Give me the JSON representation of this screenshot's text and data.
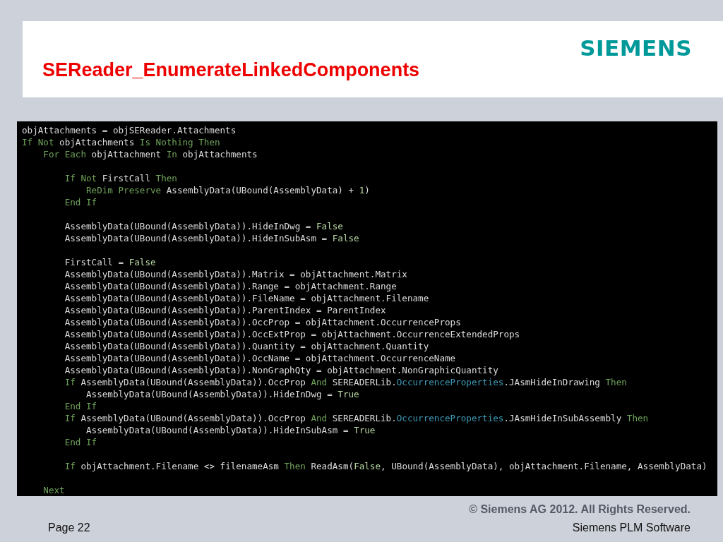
{
  "header": {
    "title": "SEReader_EnumerateLinkedComponents",
    "logo": "SIEMENS"
  },
  "code": [
    {
      "kind": "code",
      "tokens": [
        {
          "t": "objAttachments = objSEReader.Attachments",
          "kind": "plain"
        }
      ]
    },
    {
      "kind": "code",
      "tokens": [
        {
          "t": "If Not",
          "kind": "keyword"
        },
        {
          "t": " objAttachments ",
          "kind": "plain"
        },
        {
          "t": "Is Nothing Then",
          "kind": "keyword"
        }
      ]
    },
    {
      "kind": "code",
      "tokens": [
        {
          "t": "    For Each",
          "kind": "keyword"
        },
        {
          "t": " objAttachment ",
          "kind": "plain"
        },
        {
          "t": "In",
          "kind": "keyword"
        },
        {
          "t": " objAttachments",
          "kind": "plain"
        }
      ]
    },
    {
      "kind": "blank"
    },
    {
      "kind": "code",
      "tokens": [
        {
          "t": "        If Not",
          "kind": "keyword"
        },
        {
          "t": " FirstCall ",
          "kind": "plain"
        },
        {
          "t": "Then",
          "kind": "keyword"
        }
      ]
    },
    {
      "kind": "code",
      "tokens": [
        {
          "t": "            ReDim Preserve",
          "kind": "keyword"
        },
        {
          "t": " AssemblyData(UBound(AssemblyData) + ",
          "kind": "plain"
        },
        {
          "t": "1",
          "kind": "literal"
        },
        {
          "t": ")",
          "kind": "plain"
        }
      ]
    },
    {
      "kind": "code",
      "tokens": [
        {
          "t": "        End If",
          "kind": "keyword"
        }
      ]
    },
    {
      "kind": "blank"
    },
    {
      "kind": "code",
      "tokens": [
        {
          "t": "        AssemblyData(UBound(AssemblyData)).HideInDwg = ",
          "kind": "plain"
        },
        {
          "t": "False",
          "kind": "literal"
        }
      ]
    },
    {
      "kind": "code",
      "tokens": [
        {
          "t": "        AssemblyData(UBound(AssemblyData)).HideInSubAsm = ",
          "kind": "plain"
        },
        {
          "t": "False",
          "kind": "literal"
        }
      ]
    },
    {
      "kind": "blank"
    },
    {
      "kind": "code",
      "tokens": [
        {
          "t": "        FirstCall = ",
          "kind": "plain"
        },
        {
          "t": "False",
          "kind": "literal"
        }
      ]
    },
    {
      "kind": "code",
      "tokens": [
        {
          "t": "        AssemblyData(UBound(AssemblyData)).Matrix = objAttachment.Matrix",
          "kind": "plain"
        }
      ]
    },
    {
      "kind": "code",
      "tokens": [
        {
          "t": "        AssemblyData(UBound(AssemblyData)).Range = objAttachment.Range",
          "kind": "plain"
        }
      ]
    },
    {
      "kind": "code",
      "tokens": [
        {
          "t": "        AssemblyData(UBound(AssemblyData)).FileName = objAttachment.Filename",
          "kind": "plain"
        }
      ]
    },
    {
      "kind": "code",
      "tokens": [
        {
          "t": "        AssemblyData(UBound(AssemblyData)).ParentIndex = ParentIndex",
          "kind": "plain"
        }
      ]
    },
    {
      "kind": "code",
      "tokens": [
        {
          "t": "        AssemblyData(UBound(AssemblyData)).OccProp = objAttachment.OccurrenceProps",
          "kind": "plain"
        }
      ]
    },
    {
      "kind": "code",
      "tokens": [
        {
          "t": "        AssemblyData(UBound(AssemblyData)).OccExtProp = objAttachment.OccurrenceExtendedProps",
          "kind": "plain"
        }
      ]
    },
    {
      "kind": "code",
      "tokens": [
        {
          "t": "        AssemblyData(UBound(AssemblyData)).Quantity = objAttachment.Quantity",
          "kind": "plain"
        }
      ]
    },
    {
      "kind": "code",
      "tokens": [
        {
          "t": "        AssemblyData(UBound(AssemblyData)).OccName = objAttachment.OccurrenceName",
          "kind": "plain"
        }
      ]
    },
    {
      "kind": "code",
      "tokens": [
        {
          "t": "        AssemblyData(UBound(AssemblyData)).NonGraphQty = objAttachment.NonGraphicQuantity",
          "kind": "plain"
        }
      ]
    },
    {
      "kind": "code",
      "tokens": [
        {
          "t": "        If",
          "kind": "keyword"
        },
        {
          "t": " AssemblyData(UBound(AssemblyData)).OccProp ",
          "kind": "plain"
        },
        {
          "t": "And",
          "kind": "keyword"
        },
        {
          "t": " SEREADERLib.",
          "kind": "plain"
        },
        {
          "t": "OccurrenceProperties",
          "kind": "type"
        },
        {
          "t": ".JAsmHideInDrawing ",
          "kind": "plain"
        },
        {
          "t": "Then",
          "kind": "keyword"
        }
      ]
    },
    {
      "kind": "code",
      "tokens": [
        {
          "t": "            AssemblyData(UBound(AssemblyData)).HideInDwg = ",
          "kind": "plain"
        },
        {
          "t": "True",
          "kind": "literal"
        }
      ]
    },
    {
      "kind": "code",
      "tokens": [
        {
          "t": "        End If",
          "kind": "keyword"
        }
      ]
    },
    {
      "kind": "code",
      "tokens": [
        {
          "t": "        If",
          "kind": "keyword"
        },
        {
          "t": " AssemblyData(UBound(AssemblyData)).OccProp ",
          "kind": "plain"
        },
        {
          "t": "And",
          "kind": "keyword"
        },
        {
          "t": " SEREADERLib.",
          "kind": "plain"
        },
        {
          "t": "OccurrenceProperties",
          "kind": "type"
        },
        {
          "t": ".JAsmHideInSubAssembly ",
          "kind": "plain"
        },
        {
          "t": "Then",
          "kind": "keyword"
        }
      ]
    },
    {
      "kind": "code",
      "tokens": [
        {
          "t": "            AssemblyData(UBound(AssemblyData)).HideInSubAsm = ",
          "kind": "plain"
        },
        {
          "t": "True",
          "kind": "literal"
        }
      ]
    },
    {
      "kind": "code",
      "tokens": [
        {
          "t": "        End If",
          "kind": "keyword"
        }
      ]
    },
    {
      "kind": "blank"
    },
    {
      "kind": "code",
      "tokens": [
        {
          "t": "        If",
          "kind": "keyword"
        },
        {
          "t": " objAttachment.Filename <> filenameAsm ",
          "kind": "plain"
        },
        {
          "t": "Then",
          "kind": "keyword"
        },
        {
          "t": " ReadAsm(",
          "kind": "plain"
        },
        {
          "t": "False",
          "kind": "literal"
        },
        {
          "t": ", UBound(AssemblyData), objAttachment.Filename, AssemblyData)",
          "kind": "plain"
        }
      ]
    },
    {
      "kind": "blank"
    },
    {
      "kind": "code",
      "tokens": [
        {
          "t": "    Next",
          "kind": "keyword"
        }
      ]
    }
  ],
  "footer": {
    "copyright": "© Siemens AG 2012. All Rights Reserved.",
    "page": "Page 22",
    "company": "Siemens PLM Software"
  }
}
